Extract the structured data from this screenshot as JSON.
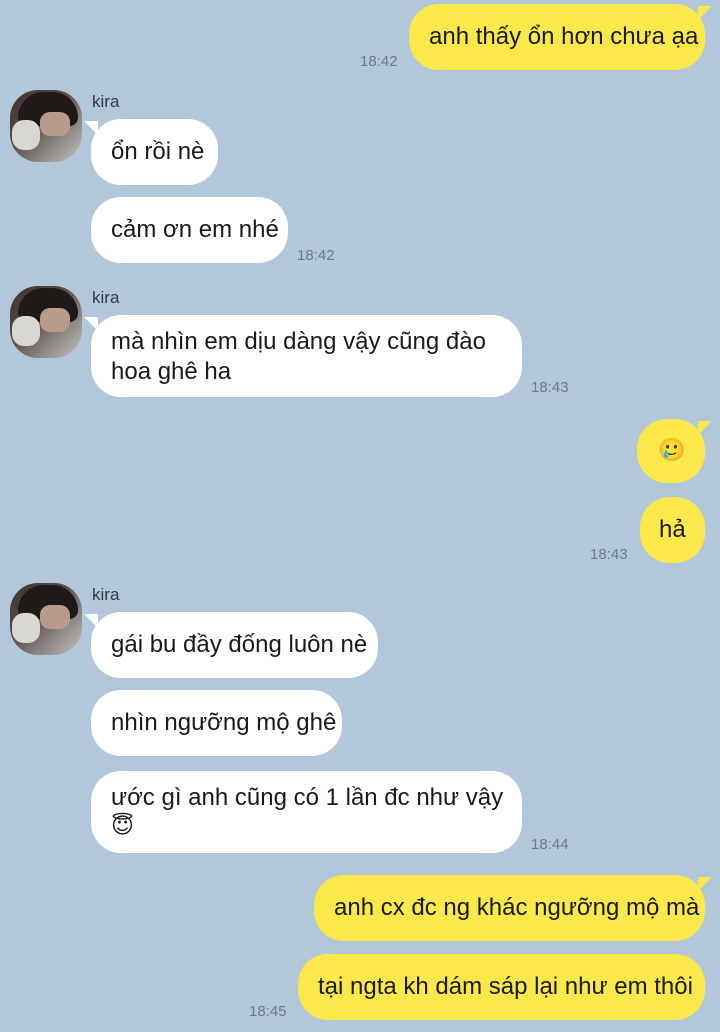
{
  "contact": {
    "name": "kira",
    "avatar_icon": "profile-photo-icon"
  },
  "colors": {
    "background": "#b2c7da",
    "outgoing_bubble": "#fbe84b",
    "incoming_bubble": "#ffffff",
    "timestamp": "#6b7b89"
  },
  "messages": [
    {
      "id": "m1",
      "direction": "out",
      "text": "anh thấy ổn hơn chưa ạa",
      "time": "18:42"
    },
    {
      "id": "m2",
      "direction": "in",
      "text": "ổn rồi nè",
      "time": ""
    },
    {
      "id": "m3",
      "direction": "in",
      "text": "cảm ơn em nhé",
      "time": "18:42"
    },
    {
      "id": "m4",
      "direction": "in",
      "text": "mà nhìn em dịu dàng vậy cũng đào",
      "text_line2": "hoa ghê ha",
      "time": "18:43"
    },
    {
      "id": "m5",
      "direction": "out",
      "text": "🥲",
      "time": ""
    },
    {
      "id": "m6",
      "direction": "out",
      "text": "hả",
      "time": "18:43"
    },
    {
      "id": "m7",
      "direction": "in",
      "text": "gái bu đầy đống luôn nè",
      "time": ""
    },
    {
      "id": "m8",
      "direction": "in",
      "text": "nhìn ngưỡng mộ ghê",
      "time": ""
    },
    {
      "id": "m9",
      "direction": "in",
      "text": "ước gì anh cũng có 1 lần đc như vậy",
      "text_line2": "😇",
      "time": "18:44"
    },
    {
      "id": "m10",
      "direction": "out",
      "text": "anh cx đc ng khác ngưỡng mộ mà",
      "time": ""
    },
    {
      "id": "m11",
      "direction": "out",
      "text": "tại ngta kh dám sáp lại như em thôi",
      "time": "18:45"
    }
  ]
}
